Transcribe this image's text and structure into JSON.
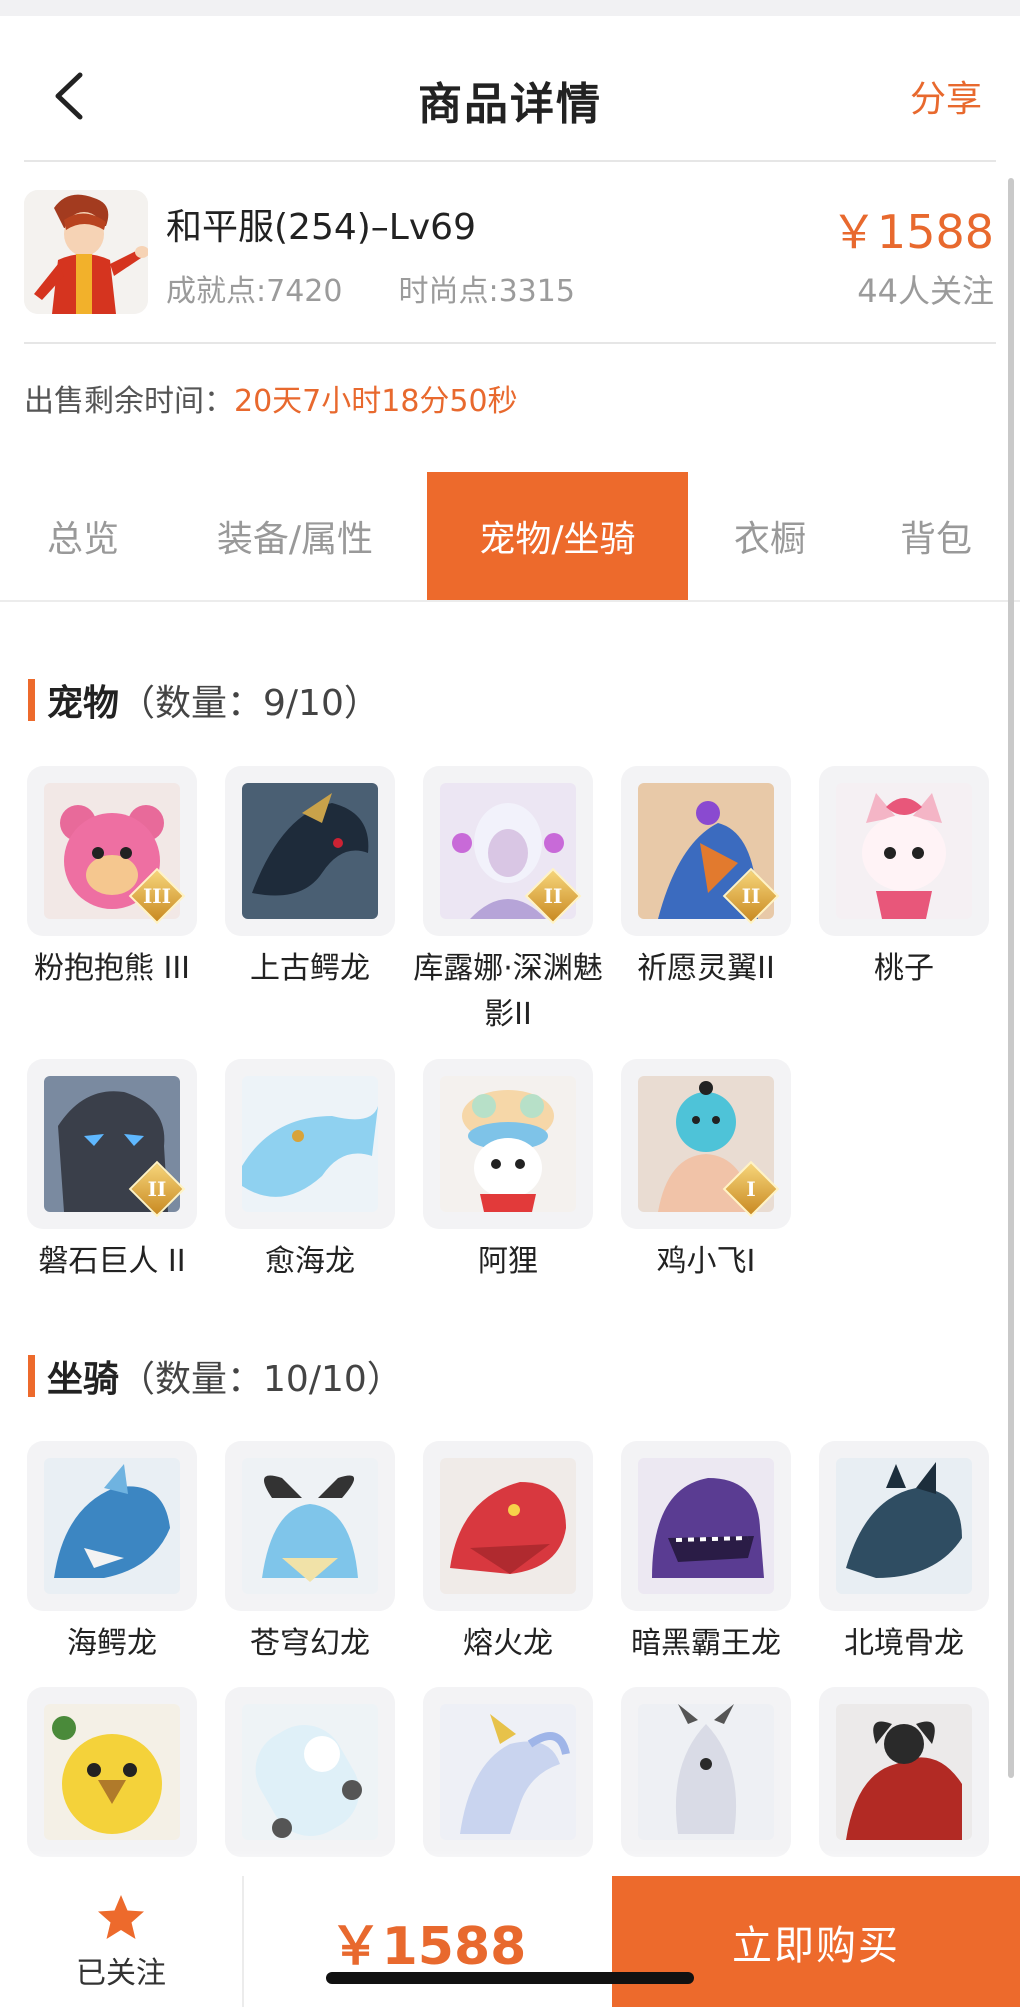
{
  "header": {
    "title": "商品详情",
    "share_label": "分享"
  },
  "product": {
    "name": "和平服(254)–Lv69",
    "achievement": "成就点:7420",
    "fashion": "时尚点:3315",
    "price": "￥1588",
    "followers": "44人关注",
    "time_label": "出售剩余时间：",
    "time_value": "20天7小时18分50秒"
  },
  "tabs": [
    {
      "label": "总览"
    },
    {
      "label": "装备/属性"
    },
    {
      "label": "宠物/坐骑",
      "active": true
    },
    {
      "label": "衣橱"
    },
    {
      "label": "背包"
    }
  ],
  "pets": {
    "title": "宠物",
    "count": "（数量：9/10）",
    "items": [
      {
        "label": "粉抱抱熊 III",
        "badge": "III",
        "icon": "pink-bear-icon"
      },
      {
        "label": "上古鳄龙",
        "badge": "",
        "icon": "crocodile-dragon-icon"
      },
      {
        "label": "库露娜·深渊魅影II",
        "badge": "II",
        "icon": "kuluna-icon"
      },
      {
        "label": "祈愿灵翼II",
        "badge": "II",
        "icon": "wish-eagle-icon"
      },
      {
        "label": "桃子",
        "badge": "",
        "icon": "peach-cat-icon"
      },
      {
        "label": "磐石巨人 II",
        "badge": "II",
        "icon": "rock-giant-icon"
      },
      {
        "label": "愈海龙",
        "badge": "",
        "icon": "sea-dragon-icon"
      },
      {
        "label": "阿狸",
        "badge": "",
        "icon": "ali-icon"
      },
      {
        "label": "鸡小飞I",
        "badge": "I",
        "icon": "chicken-icon"
      }
    ]
  },
  "mounts": {
    "title": "坐骑",
    "count": "（数量：10/10）",
    "items": [
      {
        "label": "海鳄龙",
        "icon": "sea-croc-dragon-icon"
      },
      {
        "label": "苍穹幻龙",
        "icon": "sky-dragon-icon"
      },
      {
        "label": "熔火龙",
        "icon": "lava-dragon-icon"
      },
      {
        "label": "暗黑霸王龙",
        "icon": "dark-trex-icon"
      },
      {
        "label": "北境骨龙",
        "icon": "bone-dragon-icon"
      },
      {
        "label": "",
        "icon": "rooster-mount-icon"
      },
      {
        "label": "",
        "icon": "skateboard-icon"
      },
      {
        "label": "",
        "icon": "spirit-horse-icon"
      },
      {
        "label": "",
        "icon": "silver-dragon-icon"
      },
      {
        "label": "",
        "icon": "fire-beast-icon"
      }
    ]
  },
  "bottom": {
    "follow_label": "已关注",
    "price": "￥1588",
    "buy_label": "立即购买"
  },
  "colors": {
    "accent": "#ed6a2c",
    "price": "#e8692e",
    "muted": "#9b9b9b"
  }
}
